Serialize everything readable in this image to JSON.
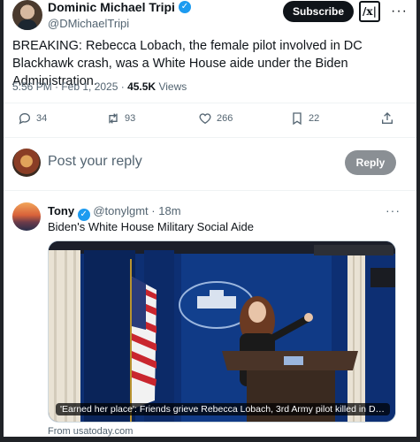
{
  "post": {
    "display_name": "Dominic Michael Tripi",
    "handle": "@DMichaelTripi",
    "subscribe_label": "Subscribe",
    "grok_label": "/x|",
    "more_label": "···",
    "text": "BREAKING: Rebecca Lobach, the female pilot involved in DC Blackhawk crash, was a White House aide under the Biden Administration.",
    "time": "5:56 PM · Feb 1, 2025 · ",
    "views_count": "45.5K",
    "views_label": " Views"
  },
  "actions": {
    "replies": "34",
    "reposts": "93",
    "likes": "266",
    "bookmarks": "22"
  },
  "composer": {
    "placeholder": "Post your reply",
    "reply_label": "Reply"
  },
  "reply_post": {
    "name": "Tony",
    "handle": "@tonylgmt",
    "time": "· 18m",
    "more_label": "···",
    "text": "Biden's White House Military Social Aide",
    "card": {
      "caption": "'Earned her place': Friends grieve Rebecca Lobach, 3rd Army pilot killed in DC c...",
      "source": "From usatoday.com"
    }
  },
  "icons": {
    "reply": "reply-icon",
    "repost": "repost-icon",
    "like": "heart-icon",
    "bookmark": "bookmark-icon",
    "share": "share-icon",
    "verified": "verified-badge-icon"
  },
  "colors": {
    "accent": "#1d9bf0",
    "text": "#0f1419",
    "muted": "#536471",
    "subscribe_bg": "#0f1419",
    "reply_btn_bg": "#8a8f94"
  }
}
